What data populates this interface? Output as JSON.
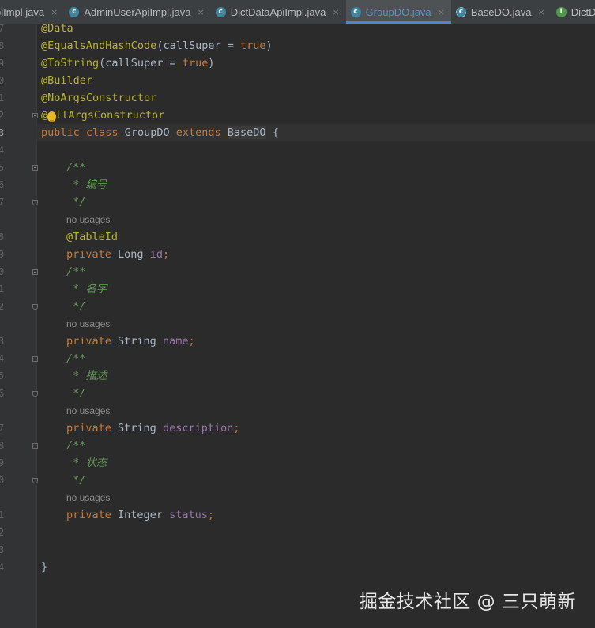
{
  "tabs": [
    {
      "label": "piImpl.java",
      "icon": "class",
      "active": false
    },
    {
      "label": "AdminUserApiImpl.java",
      "icon": "class",
      "active": false
    },
    {
      "label": "DictDataApiImpl.java",
      "icon": "class",
      "active": false
    },
    {
      "label": "GroupDO.java",
      "icon": "class",
      "active": true
    },
    {
      "label": "BaseDO.java",
      "icon": "abstract",
      "active": false
    },
    {
      "label": "DictD",
      "icon": "interface",
      "active": false
    }
  ],
  "close_glyph": "×",
  "gutter_numbers": [
    "7",
    "8",
    "9",
    "0",
    "1",
    "2",
    "3",
    "4",
    "5",
    "6",
    "7",
    "8",
    "9",
    "0",
    "1",
    "2",
    "3",
    "4",
    "5",
    "6",
    "7",
    "8",
    "9",
    "0",
    "1",
    "2",
    "3",
    "4"
  ],
  "code": {
    "anno_data": "@Data",
    "anno_equals": "@EqualsAndHashCode",
    "anno_equals_args_open": "(callSuper = ",
    "true_kw": "true",
    "close_paren": ")",
    "anno_tostring": "@ToString",
    "anno_tostring_args_open": "(callSuper = ",
    "anno_builder": "@Builder",
    "anno_noargs": "@NoArgsConstructor",
    "anno_allargs_at": "@",
    "anno_allargs_rest": "llArgsConstructor",
    "kw_public": "public",
    "kw_class": "class",
    "kw_extends": "extends",
    "class_name": "GroupDO",
    "base_class": "BaseDO",
    "open_brace": "{",
    "close_brace": "}",
    "doc_open": "/**",
    "doc_close": "*/",
    "doc_id": "* 编号",
    "doc_name": "* 名字",
    "doc_desc": "* 描述",
    "doc_status": "* 状态",
    "no_usages": "no usages",
    "anno_tableid": "@TableId",
    "kw_private": "private",
    "type_long": "Long",
    "type_string": "String",
    "type_integer": "Integer",
    "field_id": "id",
    "field_name": "name",
    "field_description": "description",
    "field_status": "status",
    "semicolon": ";"
  },
  "watermark": "掘金技术社区 @ 三只萌新"
}
